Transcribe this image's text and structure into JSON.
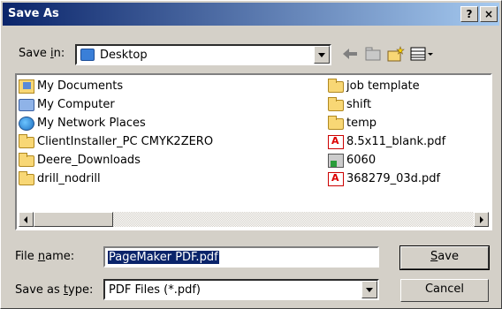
{
  "window": {
    "title": "Save As",
    "help_label": "?",
    "close_label": "×"
  },
  "save_in": {
    "label_pre": "Save ",
    "label_accel": "i",
    "label_post": "n:",
    "value": "Desktop"
  },
  "files": {
    "left": [
      {
        "name": "My Documents",
        "icon": "my-documents-icon"
      },
      {
        "name": "My Computer",
        "icon": "my-computer-icon"
      },
      {
        "name": "My Network Places",
        "icon": "network-places-icon"
      },
      {
        "name": "ClientInstaller_PC CMYK2ZERO",
        "icon": "folder-icon"
      },
      {
        "name": "Deere_Downloads",
        "icon": "folder-icon"
      },
      {
        "name": "drill_nodrill",
        "icon": "folder-icon"
      }
    ],
    "right": [
      {
        "name": "job template",
        "icon": "folder-icon"
      },
      {
        "name": "shift",
        "icon": "folder-icon"
      },
      {
        "name": "temp",
        "icon": "folder-icon"
      },
      {
        "name": "8.5x11_blank.pdf",
        "icon": "pdf-icon"
      },
      {
        "name": "6060",
        "icon": "shortcut-icon"
      },
      {
        "name": "368279_03d.pdf",
        "icon": "pdf-icon"
      }
    ]
  },
  "filename": {
    "label_pre": "File ",
    "label_accel": "n",
    "label_post": "ame:",
    "value": "PageMaker PDF.pdf"
  },
  "save_type": {
    "label_pre": "Save as ",
    "label_accel": "t",
    "label_post": "ype:",
    "value": "PDF Files (*.pdf)"
  },
  "buttons": {
    "save_accel": "S",
    "save_rest": "ave",
    "cancel": "Cancel"
  }
}
